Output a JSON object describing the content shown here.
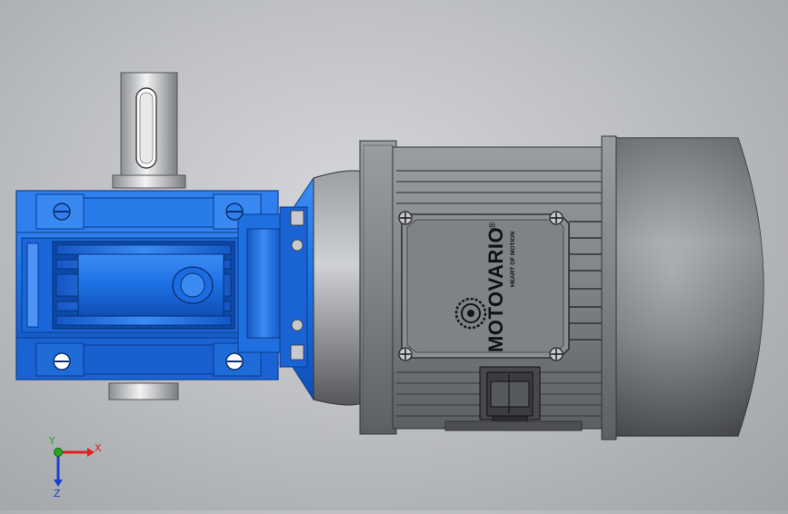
{
  "viewport": {
    "background_top": "#d4d6d9",
    "background_bottom": "#9fa2a6"
  },
  "model": {
    "gearbox_color": "#1f6fe0",
    "motor_color": "#5d5f63",
    "nameplate": {
      "brand": "MOTOVARIO",
      "registered_mark": "®",
      "tagline": "HEART OF MOTION"
    }
  },
  "triad": {
    "x_label": "X",
    "y_label": "Y",
    "z_label": "Z",
    "x_color": "#e0201a",
    "y_color": "#1fa81f",
    "z_color": "#1a3fd0"
  },
  "icons": [
    "logo-emblem-icon",
    "screw-icon",
    "triad-icon"
  ]
}
